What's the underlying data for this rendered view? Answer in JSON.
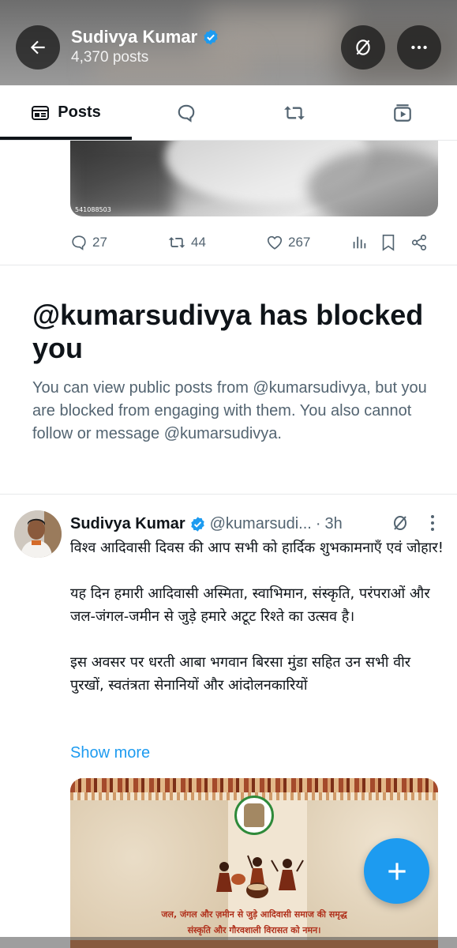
{
  "header": {
    "profile_name": "Sudivya Kumar",
    "post_count": "4,370 posts"
  },
  "tabs": [
    {
      "label": "Posts",
      "icon": "posts-icon",
      "selected": true
    },
    {
      "label": "",
      "icon": "replies-icon",
      "selected": false
    },
    {
      "label": "",
      "icon": "reposts-icon",
      "selected": false
    },
    {
      "label": "",
      "icon": "media-icon",
      "selected": false
    }
  ],
  "previous_post": {
    "media_id": "541088503",
    "replies": "27",
    "reposts": "44",
    "likes": "267"
  },
  "blocked_notice": {
    "title": "@kumarsudivya has blocked you",
    "description": "You can view public posts from @kumarsudivya, but you are blocked from engaging with them. You also cannot follow or message @kumarsudivya."
  },
  "tweet": {
    "author_name": "Sudivya Kumar",
    "handle": "@kumarsudi...",
    "separator": "·",
    "time": "3h",
    "paragraph_1": "विश्व आदिवासी दिवस की आप सभी को हार्दिक शुभकामनाएँ एवं जोहार!",
    "paragraph_2": "यह दिन हमारी आदिवासी अस्मिता, स्वाभिमान, संस्कृति, परंपराओं और जल-जंगल-जमीन से जुड़े हमारे अटूट रिश्ते का उत्सव है।",
    "paragraph_3": "इस अवसर पर धरती आबा भगवान बिरसा मुंडा सहित उन सभी वीर पुरखों, स्वतंत्रता सेनानियों और आंदोलनकारियों",
    "show_more": "Show more",
    "image_caption_line1": "जल, जंगल और ज़मीन से जुड़े आदिवासी समाज की समृद्ध",
    "image_caption_line2": "संस्कृति और गौरवशाली विरासत को नमन।"
  },
  "colors": {
    "accent": "#1d9bf0",
    "text_primary": "#0f1419",
    "text_secondary": "#536471",
    "divider": "#e7e9ea"
  }
}
